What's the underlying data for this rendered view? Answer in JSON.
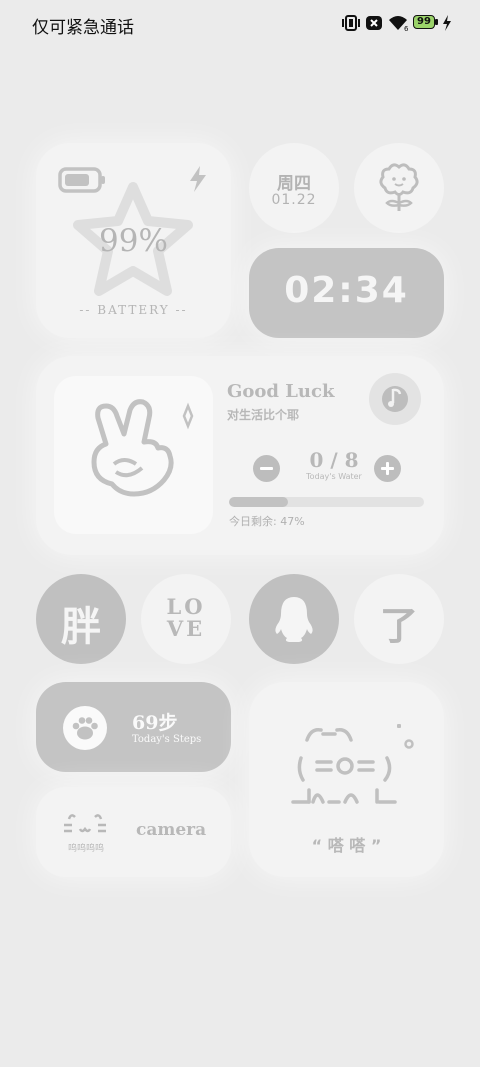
{
  "status_bar": {
    "carrier_text": "仅可紧急通话",
    "battery_level": "99",
    "icons": [
      "vibrate-icon",
      "nfc-icon",
      "wifi-icon",
      "battery-icon",
      "charging-icon"
    ]
  },
  "battery_widget": {
    "percent": "99%",
    "label": "-- BATTERY --"
  },
  "date_widget": {
    "weekday": "周四",
    "date": "01.22"
  },
  "clock_widget": {
    "time": "02:34"
  },
  "water_widget": {
    "title": "Good Luck",
    "subtitle": "对生活比个耶",
    "count": "0 / 8",
    "count_label": "Today's Water",
    "remaining": "今日剩余: 47%",
    "progress": 0.3
  },
  "app_row": {
    "item1": "胖",
    "item2_line1": "LO",
    "item2_line2": "VE",
    "item4": "了"
  },
  "steps_widget": {
    "steps": "69步",
    "label": "Today's Steps"
  },
  "camera_widget": {
    "label": "camera",
    "caption": "呜呜呜呜"
  },
  "cat_widget": {
    "caption": "“ 嗒 嗒 ”"
  },
  "colors": {
    "background": "#ebebeb",
    "card": "#f3f3f3",
    "dark_card": "#c4c4c4",
    "text_grey": "#b8b8b8"
  }
}
